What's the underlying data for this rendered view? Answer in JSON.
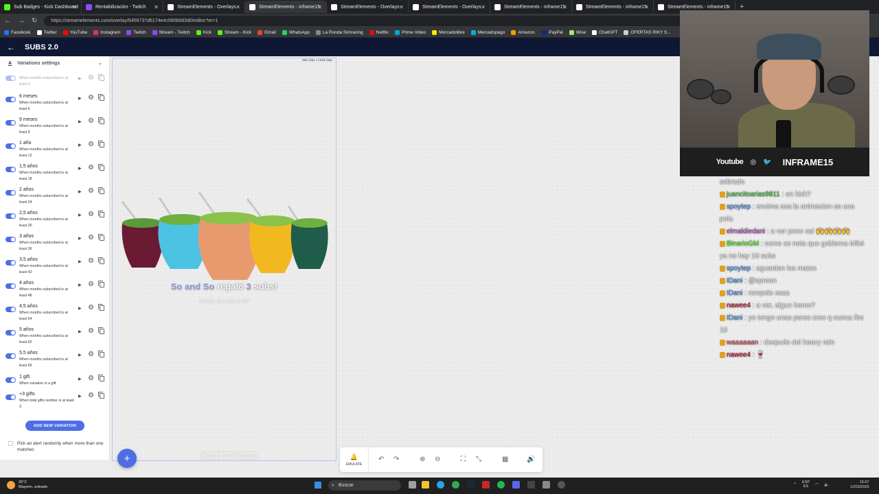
{
  "browser": {
    "tabs": [
      {
        "label": "Sub Badges - Kick Dashboard",
        "color": "#53fc18"
      },
      {
        "label": "Rentabilización - Twitch",
        "color": "#9146ff"
      },
      {
        "label": "StreamElements - Overlays",
        "color": "#ffffff"
      },
      {
        "label": "StreamElements - inframe15",
        "color": "#ffffff"
      },
      {
        "label": "StreamElements - Overlays",
        "color": "#ffffff"
      },
      {
        "label": "StreamElements - Overlays",
        "color": "#ffffff"
      },
      {
        "label": "StreamElements - inframe15",
        "color": "#ffffff"
      },
      {
        "label": "StreamElements - inframe15",
        "color": "#ffffff"
      },
      {
        "label": "StreamElements - inframe15",
        "color": "#ffffff"
      }
    ],
    "active_tab_index": 3,
    "url": "https://streamelements.com/overlay/6456737d6174e4c560b683d0/editor?er=1",
    "bookmarks": [
      {
        "label": "Facebook",
        "color": "#1877f2"
      },
      {
        "label": "Twitter",
        "color": "#ffffff"
      },
      {
        "label": "YouTube",
        "color": "#ff0000"
      },
      {
        "label": "Instagram",
        "color": "#e1306c"
      },
      {
        "label": "Twitch",
        "color": "#9146ff"
      },
      {
        "label": "Stream - Twitch",
        "color": "#9146ff"
      },
      {
        "label": "Kick",
        "color": "#53fc18"
      },
      {
        "label": "Stream - Kick",
        "color": "#53fc18"
      },
      {
        "label": "Gmail",
        "color": "#ea4335"
      },
      {
        "label": "WhatsApp",
        "color": "#25d366"
      },
      {
        "label": "La Ronda Simracing",
        "color": "#888888"
      },
      {
        "label": "Netflix",
        "color": "#e50914"
      },
      {
        "label": "Prime Video",
        "color": "#00a8e1"
      },
      {
        "label": "Mercadolibre",
        "color": "#ffe600"
      },
      {
        "label": "Mercadopago",
        "color": "#00b1ea"
      },
      {
        "label": "Amazon.",
        "color": "#ff9900"
      },
      {
        "label": "PayPal",
        "color": "#003087"
      },
      {
        "label": "Wise",
        "color": "#9fe870"
      },
      {
        "label": "ChatGPT",
        "color": "#ffffff"
      },
      {
        "label": "OFERTAS RIKY S...",
        "color": "#cccccc"
      }
    ]
  },
  "app": {
    "title": "SUBS 2.0",
    "section_title": "Variations settings",
    "first_variation_desc": "When months subscribed is at least 3",
    "variations": [
      {
        "name": "6 meses",
        "desc": "When months subscribed is at least 6"
      },
      {
        "name": "9 meses",
        "desc": "When months subscribed is at least 9"
      },
      {
        "name": "1 año",
        "desc": "When months subscribed is at least 12"
      },
      {
        "name": "1,5 años",
        "desc": "When months subscribed is at least 18"
      },
      {
        "name": "2 años",
        "desc": "When months subscribed is at least 24"
      },
      {
        "name": "2,5 años",
        "desc": "When months subscribed is at least 30"
      },
      {
        "name": "3 años",
        "desc": "When months subscribed is at least 36"
      },
      {
        "name": "3,5 años",
        "desc": "When months subscribed is at least 42"
      },
      {
        "name": "4 años",
        "desc": "When months subscribed is at least 48"
      },
      {
        "name": "4,5 años",
        "desc": "When months subscribed is at least 54"
      },
      {
        "name": "5 años",
        "desc": "When months subscribed is at least 60"
      },
      {
        "name": "5,5 años",
        "desc": "When months subscribed is at least 66"
      },
      {
        "name": "1 gift",
        "desc": "When variation is a gift"
      },
      {
        "name": "+3 gifts",
        "desc": "When total gifts number is at least 3"
      }
    ],
    "add_variation_label": "ADD NEW VARIATION",
    "random_option_label": "Pick an alert randomly when more than one matches",
    "frame_size": "580.13px x 1049.19px",
    "alert_text_parts": [
      "So and So",
      " regaló ",
      "3",
      " subs!"
    ],
    "alert_message": "Howdy, my name is Bill",
    "delete_hint": "Delete with",
    "delete_key": "delete",
    "emulate_label": "EMULATE",
    "accent_color": "#4f6ee6"
  },
  "webcam": {
    "social_youtube": "Youtube",
    "social_name": "INFRAME15"
  },
  "chat": [
    {
      "user": "",
      "text": "sobrado",
      "color": "#ffffff"
    },
    {
      "user": "juancitoarias9811",
      "text": " : en kick?",
      "color": "#46d14a"
    },
    {
      "user": "spoytep",
      "text": " : encima aca la animacion es una poia",
      "color": "#5aa0f0"
    },
    {
      "user": "elmaldiedani",
      "text": " : a ver pone asi 🙌🙌🙌🙌",
      "color": "#c25ad0"
    },
    {
      "user": "BinarioGM",
      "text": " : como se nota que gobierna Milei ya no hay 10 subs",
      "color": "#53fc18"
    },
    {
      "user": "spoytep",
      "text": " : aguanten los mates",
      "color": "#5aa0f0"
    },
    {
      "user": "IDani",
      "text": " : @spreen",
      "color": "#5aa0f0"
    },
    {
      "user": "IDani",
      "text": " : rompele esas",
      "color": "#5aa0f0"
    },
    {
      "user": "nawee4",
      "text": " : a ver, algun heroe?",
      "color": "#d11a3a"
    },
    {
      "user": "IDani",
      "text": " : yo tengo unas pares creo q nunca fire 10",
      "color": "#5aa0f0"
    },
    {
      "user": "waaaaaan",
      "text": " : después del heavy rain",
      "color": "#e05a6a"
    },
    {
      "user": "nawee4",
      "text": " : 🍷",
      "color": "#d11a3a"
    }
  ],
  "taskbar": {
    "temperature": "26°C",
    "weather": "Mayorm. soleado",
    "search_label": "Buscar",
    "lang": "ESP",
    "lang_sub": "ES",
    "time": "15:07",
    "date": "12/03/2026"
  }
}
